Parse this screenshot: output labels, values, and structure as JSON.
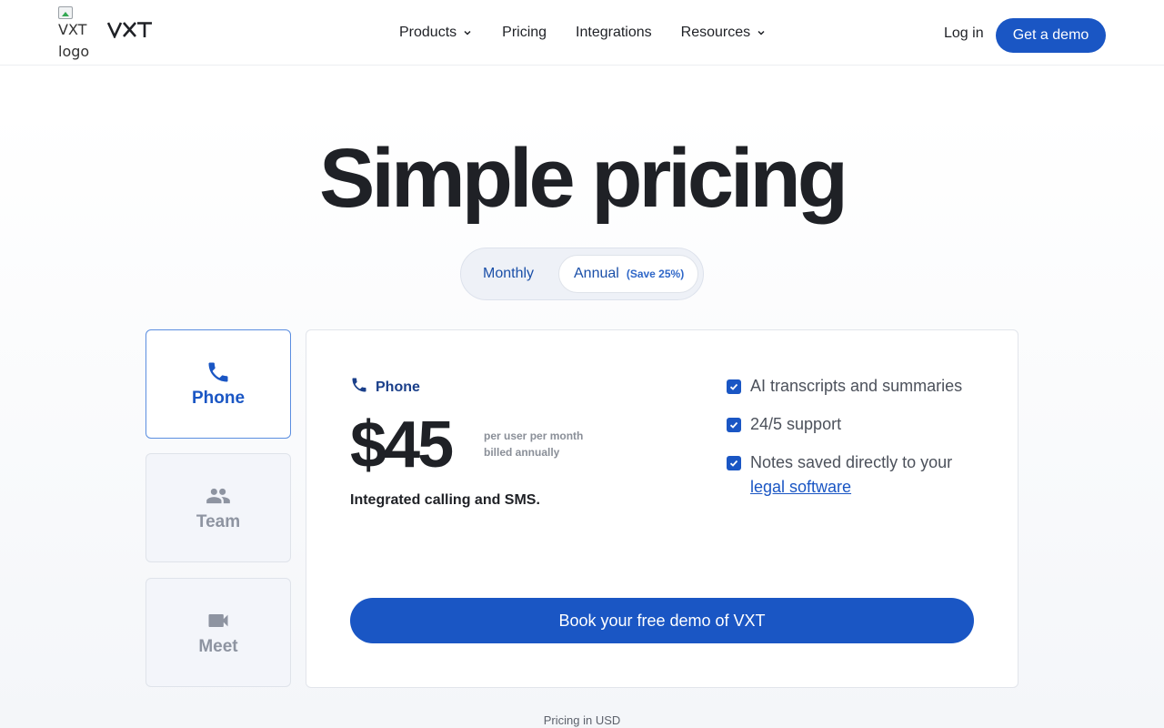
{
  "header": {
    "logo_alt": "VXT logo",
    "brand": "VXT",
    "nav": [
      {
        "label": "Products",
        "has_dropdown": true
      },
      {
        "label": "Pricing",
        "has_dropdown": false
      },
      {
        "label": "Integrations",
        "has_dropdown": false
      },
      {
        "label": "Resources",
        "has_dropdown": true
      }
    ],
    "login_label": "Log in",
    "cta_label": "Get a demo"
  },
  "hero": {
    "title": "Simple pricing"
  },
  "billing_toggle": {
    "monthly_label": "Monthly",
    "annual_label": "Annual",
    "annual_badge": "(Save 25%)",
    "selected": "annual"
  },
  "plan_tabs": [
    {
      "label": "Phone",
      "icon": "phone-icon",
      "active": true
    },
    {
      "label": "Team",
      "icon": "people-icon",
      "active": false
    },
    {
      "label": "Meet",
      "icon": "video-camera-icon",
      "active": false
    }
  ],
  "plan": {
    "name": "Phone",
    "icon": "phone-icon",
    "price": "$45",
    "price_note_line1": "per user per month",
    "price_note_line2": "billed annually",
    "tagline": "Integrated calling and SMS.",
    "features": [
      {
        "text": "AI transcripts and summaries",
        "link": ""
      },
      {
        "text": "24/5 support",
        "link": ""
      },
      {
        "text": "Notes saved directly to your",
        "link": "legal software"
      }
    ],
    "cta_label": "Book your free demo of VXT"
  },
  "footer": {
    "pricing_note": "Pricing in  USD"
  },
  "colors": {
    "accent": "#1a56c4",
    "accent_dark": "#1a3f8a",
    "text": "#1f2126",
    "muted": "#8e94a1"
  }
}
